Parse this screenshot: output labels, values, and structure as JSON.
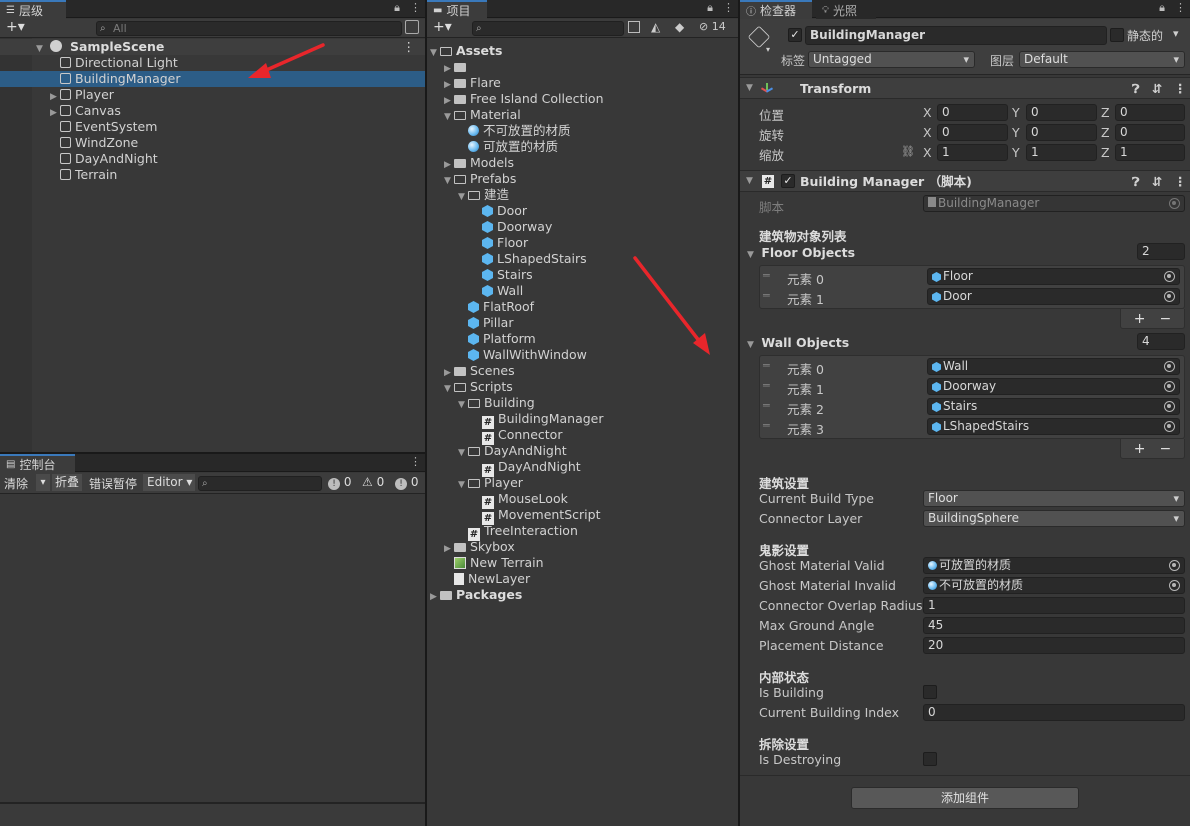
{
  "hierarchy": {
    "tab_label": "层级",
    "search_placeholder": "All",
    "scene": "SampleScene",
    "items": [
      {
        "label": "Directional Light",
        "selected": false,
        "expandable": false
      },
      {
        "label": "BuildingManager",
        "selected": true,
        "expandable": false
      },
      {
        "label": "Player",
        "selected": false,
        "expandable": true
      },
      {
        "label": "Canvas",
        "selected": false,
        "expandable": true
      },
      {
        "label": "EventSystem",
        "selected": false,
        "expandable": false
      },
      {
        "label": "WindZone",
        "selected": false,
        "expandable": false
      },
      {
        "label": "DayAndNight",
        "selected": false,
        "expandable": false
      },
      {
        "label": "Terrain",
        "selected": false,
        "expandable": false
      }
    ]
  },
  "console": {
    "tab_label": "控制台",
    "clear_label": "清除",
    "collapse_label": "折叠",
    "error_pause_label": "错误暂停",
    "editor_label": "Editor",
    "log_count": "0",
    "warn_count": "0",
    "error_count": "0"
  },
  "project": {
    "tab_label": "项目",
    "hidden_count": "14",
    "tree": [
      {
        "label": "Assets",
        "icon": "folder-open",
        "bold": true
      },
      {
        "label": "",
        "icon": "folder",
        "bold": false
      },
      {
        "label": "Flare",
        "icon": "folder",
        "bold": false
      },
      {
        "label": "Free Island Collection",
        "icon": "folder",
        "bold": false
      },
      {
        "label": "Material",
        "icon": "folder-open",
        "bold": false
      },
      {
        "label": "不可放置的材质",
        "icon": "material",
        "bold": false
      },
      {
        "label": "可放置的材质",
        "icon": "material",
        "bold": false
      },
      {
        "label": "Models",
        "icon": "folder",
        "bold": false
      },
      {
        "label": "Prefabs",
        "icon": "folder-open",
        "bold": false
      },
      {
        "label": "建造",
        "icon": "folder-open",
        "bold": false
      },
      {
        "label": "Door",
        "icon": "prefab",
        "bold": false
      },
      {
        "label": "Doorway",
        "icon": "prefab",
        "bold": false
      },
      {
        "label": "Floor",
        "icon": "prefab",
        "bold": false
      },
      {
        "label": "LShapedStairs",
        "icon": "prefab",
        "bold": false
      },
      {
        "label": "Stairs",
        "icon": "prefab",
        "bold": false
      },
      {
        "label": "Wall",
        "icon": "prefab",
        "bold": false
      },
      {
        "label": "FlatRoof",
        "icon": "prefab",
        "bold": false
      },
      {
        "label": "Pillar",
        "icon": "prefab",
        "bold": false
      },
      {
        "label": "Platform",
        "icon": "prefab",
        "bold": false
      },
      {
        "label": "WallWithWindow",
        "icon": "prefab",
        "bold": false
      },
      {
        "label": "Scenes",
        "icon": "folder",
        "bold": false
      },
      {
        "label": "Scripts",
        "icon": "folder-open",
        "bold": false
      },
      {
        "label": "Building",
        "icon": "folder-open",
        "bold": false
      },
      {
        "label": "BuildingManager",
        "icon": "script",
        "bold": false
      },
      {
        "label": "Connector",
        "icon": "script",
        "bold": false
      },
      {
        "label": "DayAndNight",
        "icon": "folder-open",
        "bold": false
      },
      {
        "label": "DayAndNight",
        "icon": "script",
        "bold": false
      },
      {
        "label": "Player",
        "icon": "folder-open",
        "bold": false
      },
      {
        "label": "MouseLook",
        "icon": "script",
        "bold": false
      },
      {
        "label": "MovementScript",
        "icon": "script",
        "bold": false
      },
      {
        "label": "TreeInteraction",
        "icon": "script",
        "bold": false
      },
      {
        "label": "Skybox",
        "icon": "folder",
        "bold": false
      },
      {
        "label": "New Terrain",
        "icon": "terrain",
        "bold": false
      },
      {
        "label": "NewLayer",
        "icon": "file",
        "bold": false
      },
      {
        "label": "Packages",
        "icon": "folder",
        "bold": true
      }
    ]
  },
  "inspector": {
    "tab_label": "检查器",
    "lighting_tab_label": "光照",
    "object_name": "BuildingManager",
    "static_label": "静态的",
    "tag_label": "标签",
    "tag_value": "Untagged",
    "layer_label": "图层",
    "layer_value": "Default",
    "transform": {
      "title": "Transform",
      "position_label": "位置",
      "rotation_label": "旋转",
      "scale_label": "缩放",
      "position": [
        "0",
        "0",
        "0"
      ],
      "rotation": [
        "0",
        "0",
        "0"
      ],
      "scale": [
        "1",
        "1",
        "1"
      ],
      "axis_labels": [
        "X",
        "Y",
        "Z"
      ]
    },
    "component": {
      "title": "Building Manager （脚本)",
      "script_label": "脚本",
      "script_value": "BuildingManager",
      "section_objects": "建筑物对象列表",
      "floor_objects_label": "Floor Objects",
      "floor_objects_count": "2",
      "floor_objects": [
        {
          "label": "元素 0",
          "value": "Floor"
        },
        {
          "label": "元素 1",
          "value": "Door"
        }
      ],
      "wall_objects_label": "Wall Objects",
      "wall_objects_count": "4",
      "wall_objects": [
        {
          "label": "元素 0",
          "value": "Wall"
        },
        {
          "label": "元素 1",
          "value": "Doorway"
        },
        {
          "label": "元素 2",
          "value": "Stairs"
        },
        {
          "label": "元素 3",
          "value": "LShapedStairs"
        }
      ],
      "section_build": "建筑设置",
      "current_build_type_label": "Current Build Type",
      "current_build_type_value": "Floor",
      "connector_layer_label": "Connector Layer",
      "connector_layer_value": "BuildingSphere",
      "section_ghost": "鬼影设置",
      "ghost_valid_label": "Ghost Material Valid",
      "ghost_valid_value": "可放置的材质",
      "ghost_invalid_label": "Ghost Material Invalid",
      "ghost_invalid_value": "不可放置的材质",
      "overlap_radius_label": "Connector Overlap Radius",
      "overlap_radius_value": "1",
      "max_ground_angle_label": "Max Ground Angle",
      "max_ground_angle_value": "45",
      "placement_distance_label": "Placement Distance",
      "placement_distance_value": "20",
      "section_internal": "内部状态",
      "is_building_label": "Is Building",
      "current_building_index_label": "Current Building Index",
      "current_building_index_value": "0",
      "section_destroy": "拆除设置",
      "is_destroying_label": "Is Destroying"
    },
    "add_component_label": "添加组件"
  },
  "colors": {
    "selection": "#2c5d87",
    "arrow": "#e8262b",
    "prefab": "#5cb6f0"
  }
}
